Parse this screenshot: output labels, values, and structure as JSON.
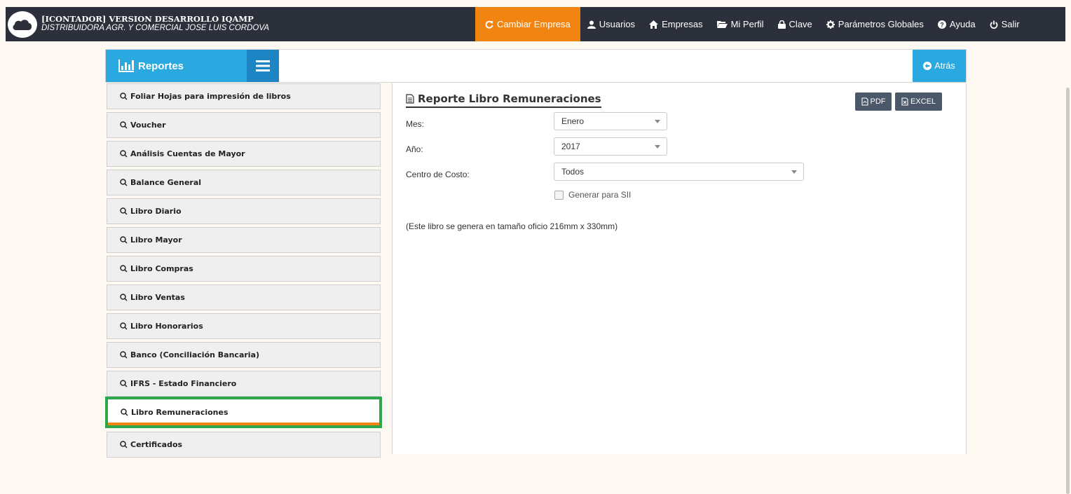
{
  "app": {
    "title": "[ICONTADOR] VERSION DESARROLLO IQAMP",
    "company": "DISTRIBUIDORA AGR. Y COMERCIAL JOSE LUIS CORDOVA"
  },
  "nav": {
    "change_company": "Cambiar Empresa",
    "users": "Usuarios",
    "companies": "Empresas",
    "profile": "Mi Perfil",
    "password": "Clave",
    "global_params": "Parámetros Globales",
    "help": "Ayuda",
    "logout": "Salir"
  },
  "panel": {
    "reports_label": "Reportes",
    "back_label": "Atrás"
  },
  "sidebar": {
    "items": [
      {
        "label": "Foliar Hojas para impresión de libros"
      },
      {
        "label": "Voucher"
      },
      {
        "label": "Análisis Cuentas de Mayor"
      },
      {
        "label": "Balance General"
      },
      {
        "label": "Libro Diario"
      },
      {
        "label": "Libro Mayor"
      },
      {
        "label": "Libro Compras"
      },
      {
        "label": "Libro Ventas"
      },
      {
        "label": "Libro Honorarios"
      },
      {
        "label": "Banco (Conciliación Bancaria)"
      },
      {
        "label": "IFRS - Estado Financiero"
      },
      {
        "label": "Libro Remuneraciones"
      },
      {
        "label": "Certificados"
      }
    ],
    "active_index": 11
  },
  "report": {
    "title": "Reporte Libro Remuneraciones",
    "pdf_label": "PDF",
    "excel_label": "EXCEL",
    "month_label": "Mes:",
    "month_value": "Enero",
    "year_label": "Año:",
    "year_value": "2017",
    "cost_center_label": "Centro de Costo:",
    "cost_center_value": "Todos",
    "sii_label": "Generar para SII",
    "note": "(Este libro se genera en tamaño oficio 216mm x 330mm)"
  },
  "colors": {
    "topbar": "#2b303a",
    "accent_orange": "#f28512",
    "accent_blue": "#29a9e0",
    "highlight_green": "#2ba84a",
    "export_button": "#4a5869"
  }
}
